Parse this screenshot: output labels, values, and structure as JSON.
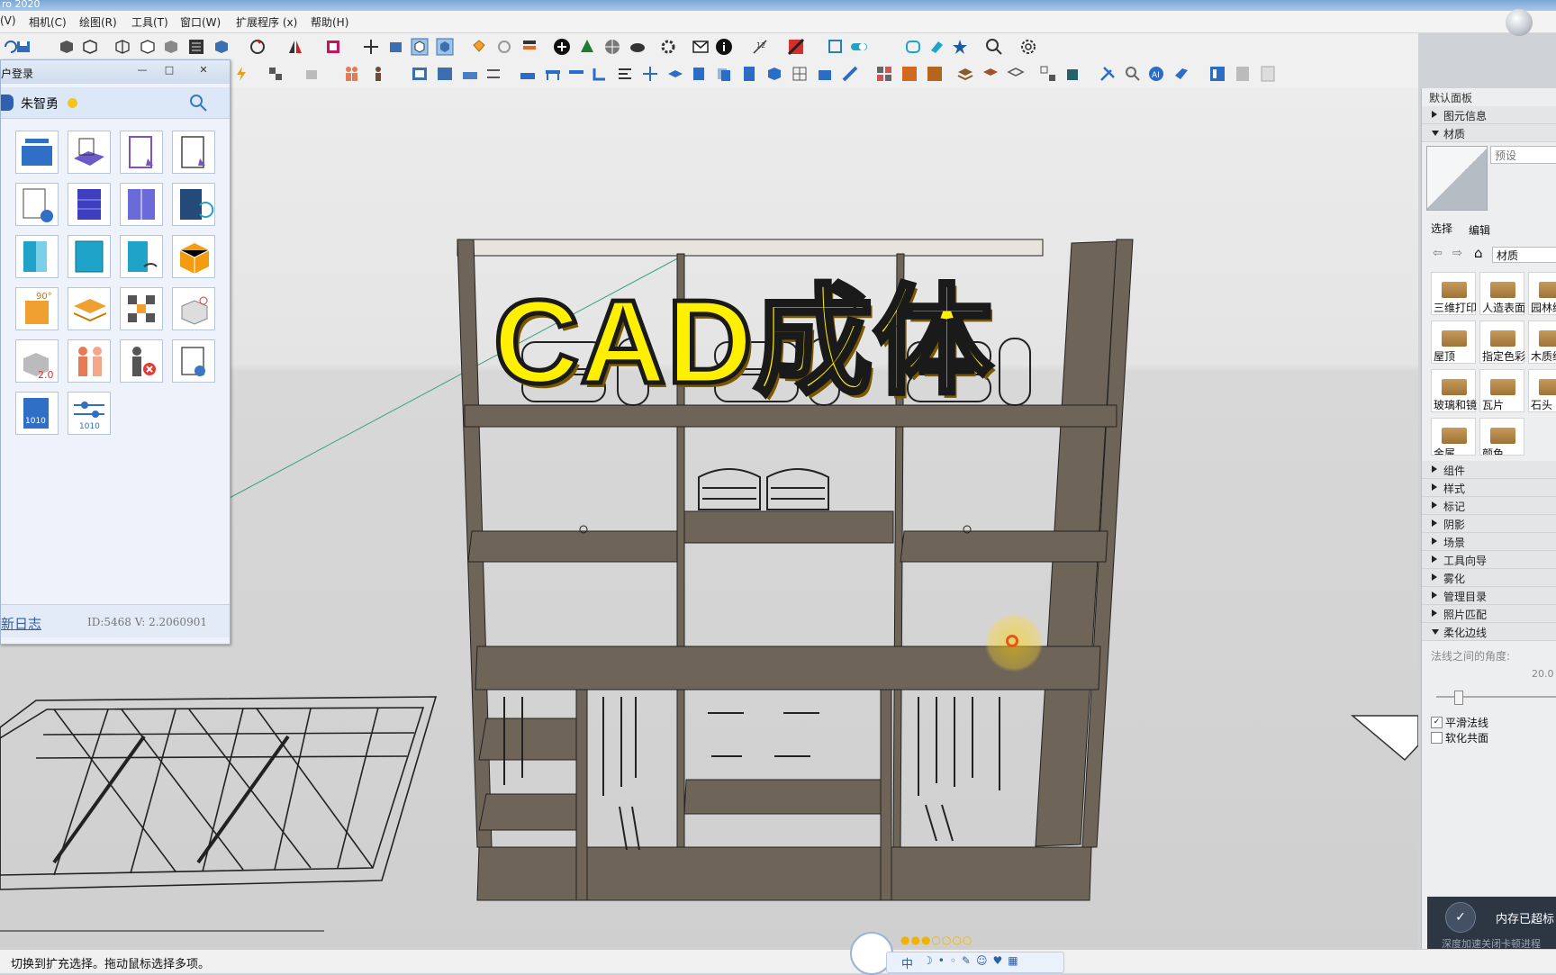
{
  "window_title": "ro 2020",
  "menu": [
    "(V)",
    "相机(C)",
    "绘图(R)",
    "工具(T)",
    "窗口(W)",
    "扩展程序 (x)",
    "帮助(H)"
  ],
  "overlay_title": "CAD成体",
  "plugin": {
    "header": "户登录",
    "user_name": "朱智勇",
    "footer_link": "新日志",
    "version": "ID:5468  V: 2.2060901",
    "tool_icons": [
      "wardrobe-layout-icon",
      "cad-import-icon",
      "cabinet-select-icon",
      "box-select-icon",
      "ai-cabinet-icon",
      "bookcase-icon",
      "door-panel-icon",
      "sliding-door-icon",
      "single-door-icon",
      "panel-icon",
      "door-hinge-icon",
      "box-3d-icon",
      "rotate-90-icon",
      "layer-stack-icon",
      "checker-icon",
      "corner-rotate-icon",
      "version-2-icon",
      "people-icon",
      "person-remove-icon",
      "box-2d-icon",
      "file-binary-icon",
      "sliders-binary-icon"
    ]
  },
  "right_panel": {
    "panel_title": "默认面板",
    "entity_info": "图元信息",
    "materials": "材质",
    "preset": "预设",
    "tab_select": "选择",
    "tab_edit": "编辑",
    "breadcrumb": "材质",
    "material_items": [
      "三维打印",
      "人造表面",
      "园林绿",
      "屋顶",
      "指定色彩",
      "木质纹",
      "玻璃和镜",
      "瓦片",
      "石头",
      "金属",
      "颜色"
    ],
    "sections": [
      "组件",
      "样式",
      "标记",
      "阴影",
      "场景",
      "工具向导",
      "雾化",
      "管理目录",
      "照片匹配"
    ],
    "soften_edges": "柔化边线",
    "angle_label": "法线之间的角度:",
    "angle_value": "20.0",
    "smooth_normals": "平滑法线",
    "soften_coplanar": "软化共面"
  },
  "memory_notice": {
    "title": "内存已超标",
    "detail": "深度加速关闭卡顿进程"
  },
  "status_text": "切换到扩充选择。拖动鼠标选择多项。",
  "ime_label": "中",
  "colors": {
    "shelf": "#6e6457",
    "overlay_text": "#ffef00",
    "accent": "#e8541d"
  }
}
